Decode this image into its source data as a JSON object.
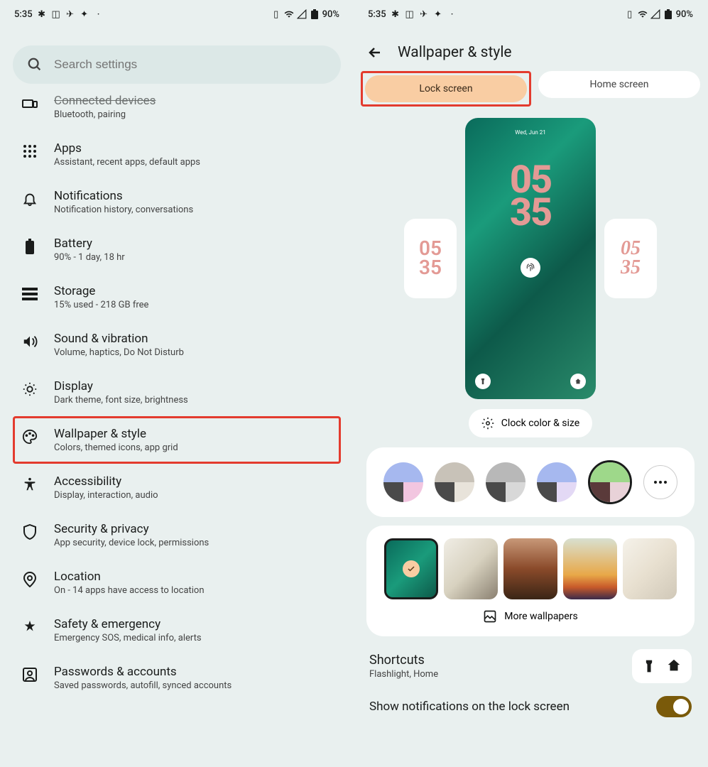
{
  "status": {
    "time": "5:35",
    "battery": "90%"
  },
  "left": {
    "search_placeholder": "Search settings",
    "items": [
      {
        "title": "Connected devices",
        "subtitle": "Bluetooth, pairing"
      },
      {
        "title": "Apps",
        "subtitle": "Assistant, recent apps, default apps"
      },
      {
        "title": "Notifications",
        "subtitle": "Notification history, conversations"
      },
      {
        "title": "Battery",
        "subtitle": "90% - 1 day, 18 hr"
      },
      {
        "title": "Storage",
        "subtitle": "15% used - 218 GB free"
      },
      {
        "title": "Sound & vibration",
        "subtitle": "Volume, haptics, Do Not Disturb"
      },
      {
        "title": "Display",
        "subtitle": "Dark theme, font size, brightness"
      },
      {
        "title": "Wallpaper & style",
        "subtitle": "Colors, themed icons, app grid"
      },
      {
        "title": "Accessibility",
        "subtitle": "Display, interaction, audio"
      },
      {
        "title": "Security & privacy",
        "subtitle": "App security, device lock, permissions"
      },
      {
        "title": "Location",
        "subtitle": "On - 14 apps have access to location"
      },
      {
        "title": "Safety & emergency",
        "subtitle": "Emergency SOS, medical info, alerts"
      },
      {
        "title": "Passwords & accounts",
        "subtitle": "Saved passwords, autofill, synced accounts"
      }
    ]
  },
  "right": {
    "title": "Wallpaper & style",
    "tabs": {
      "lock": "Lock screen",
      "home": "Home screen"
    },
    "preview": {
      "date": "Wed, Jun 21",
      "time1": "05",
      "time2": "35",
      "side_time1": "05",
      "side_time2": "35"
    },
    "clock_button": "Clock color & size",
    "more_wallpapers": "More wallpapers",
    "shortcuts": {
      "title": "Shortcuts",
      "subtitle": "Flashlight, Home"
    },
    "notifications_label": "Show notifications on the lock screen",
    "color_swatches": [
      {
        "tl": "#a6b8ef",
        "tr": "#a6b8ef",
        "bl": "#4a4a4a",
        "br": "#f2c6e0"
      },
      {
        "tl": "#c8c2b8",
        "tr": "#c8c2b8",
        "bl": "#4a4a4a",
        "br": "#e8e3da"
      },
      {
        "tl": "#b8b8b8",
        "tr": "#b8b8b8",
        "bl": "#4a4a4a",
        "br": "#d8d8d8"
      },
      {
        "tl": "#a6b8ef",
        "tr": "#a6b8ef",
        "bl": "#4a4a4a",
        "br": "#e3d9f5"
      },
      {
        "tl": "#9ed88a",
        "tr": "#9ed88a",
        "bl": "#5a3a3a",
        "br": "#e8d2d8",
        "selected": true
      }
    ]
  }
}
